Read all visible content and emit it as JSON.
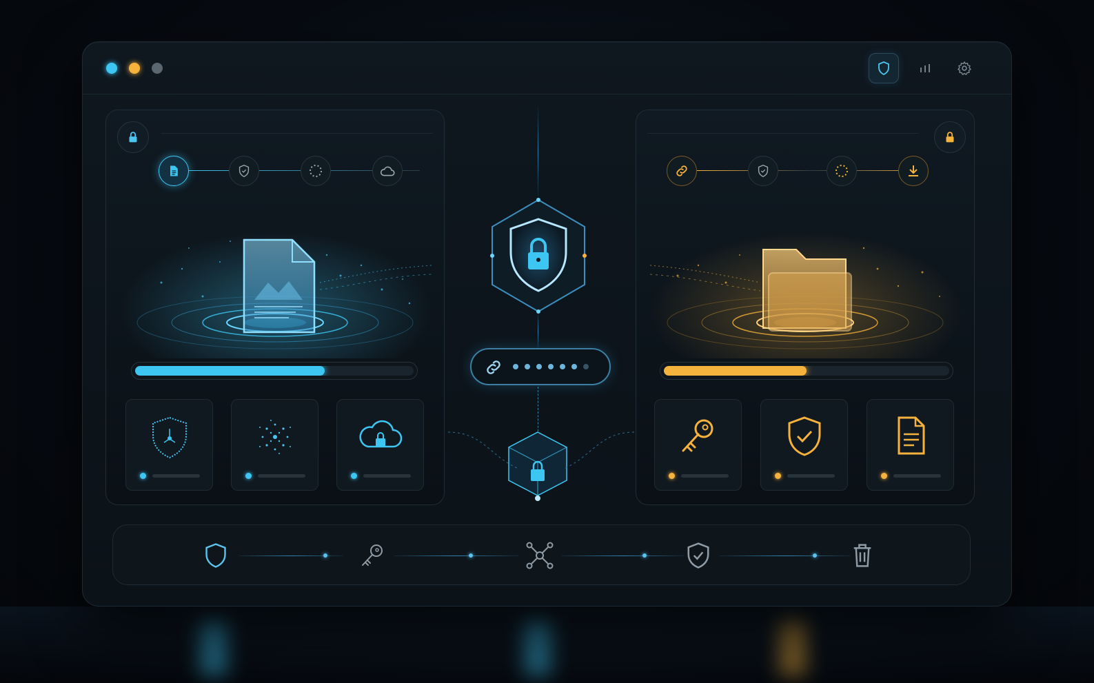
{
  "window": {
    "traffic_lights": [
      {
        "name": "dot-cyan",
        "color": "#3ec6f2"
      },
      {
        "name": "dot-amber",
        "color": "#f5b23c"
      },
      {
        "name": "dot-gray",
        "color": "#5a6670"
      }
    ],
    "toolbar": [
      {
        "icon": "shield-icon",
        "active": true
      },
      {
        "icon": "bar-chart-icon",
        "active": false
      },
      {
        "icon": "gear-icon",
        "active": false
      }
    ]
  },
  "colors": {
    "accent_blue": "#3ec6f2",
    "accent_amber": "#f5b23c",
    "panel_border": "#1f2d38",
    "background": "#070b11"
  },
  "source_panel": {
    "lock_icon": "lock-icon",
    "steps": [
      "document-icon",
      "shield-check-icon",
      "loading-ring-icon",
      "cloud-icon"
    ],
    "active_step": 0,
    "hero_icon": "document-image-icon",
    "progress": 0.68,
    "tiles": [
      {
        "icon": "circuit-shield-icon"
      },
      {
        "icon": "particle-sphere-icon"
      },
      {
        "icon": "cloud-lock-icon"
      }
    ]
  },
  "target_panel": {
    "lock_icon": "lock-icon",
    "steps": [
      "link-icon",
      "shield-check-icon",
      "loading-ring-icon",
      "download-icon"
    ],
    "active_step": 0,
    "hero_icon": "folder-icon",
    "progress": 0.5,
    "tiles": [
      {
        "icon": "key-icon"
      },
      {
        "icon": "shield-check-icon"
      },
      {
        "icon": "document-lines-icon"
      }
    ]
  },
  "center": {
    "hub_icon": "shield-lock-icon",
    "password_field": {
      "icon": "link-icon",
      "filled_dots": 6,
      "total_dots": 7
    },
    "vault_icon": "cube-lock-icon"
  },
  "bottom_bar": {
    "items": [
      "shield-icon",
      "key-icon",
      "network-icon",
      "shield-check-icon",
      "trash-icon"
    ]
  }
}
